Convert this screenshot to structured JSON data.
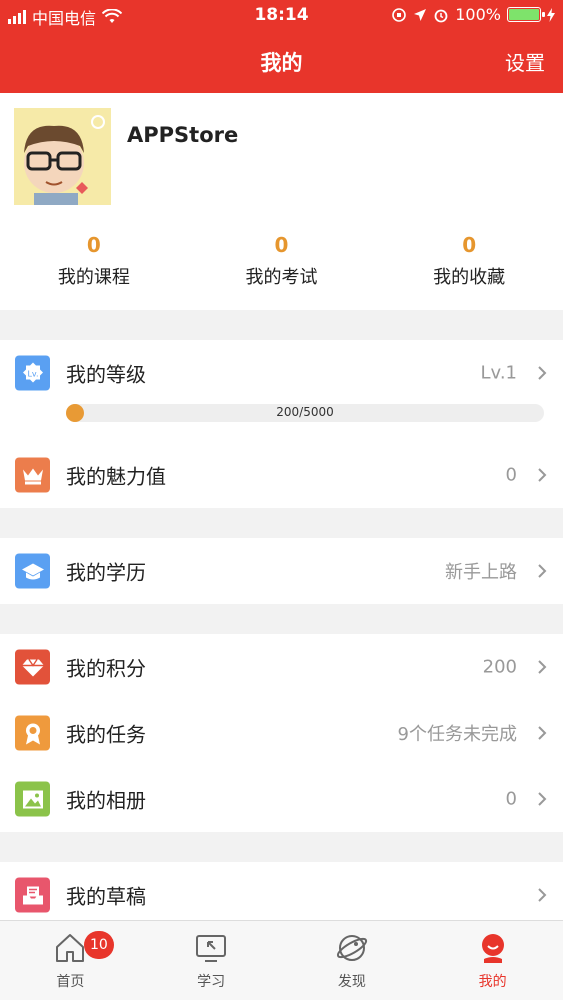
{
  "status_bar": {
    "carrier": "中国电信",
    "time": "18:14",
    "battery": "100%"
  },
  "nav": {
    "title": "我的",
    "settings_label": "设置"
  },
  "profile": {
    "username": "APPStore",
    "stats": [
      {
        "count": "0",
        "label": "我的课程"
      },
      {
        "count": "0",
        "label": "我的考试"
      },
      {
        "count": "0",
        "label": "我的收藏"
      }
    ]
  },
  "rows": {
    "level": {
      "label": "我的等级",
      "value": "Lv.1",
      "icon": "level-badge-icon",
      "color": "#5aa0f2"
    },
    "level_progress": {
      "text": "200/5000",
      "fraction": 0.04
    },
    "charm": {
      "label": "我的魅力值",
      "value": "0",
      "icon": "crown-icon",
      "color": "#ec7d4c"
    },
    "education": {
      "label": "我的学历",
      "value": "新手上路",
      "icon": "graduation-cap-icon",
      "color": "#5aa0f2"
    },
    "points": {
      "label": "我的积分",
      "value": "200",
      "icon": "diamond-icon",
      "color": "#e2523a"
    },
    "tasks": {
      "label": "我的任务",
      "value": "9个任务未完成",
      "icon": "award-ribbon-icon",
      "color": "#ef9a3d"
    },
    "album": {
      "label": "我的相册",
      "value": "0",
      "icon": "picture-icon",
      "color": "#8bc34a"
    },
    "drafts": {
      "label": "我的草稿",
      "value": "",
      "icon": "drafts-tray-icon",
      "color": "#e8566c"
    }
  },
  "tabbar": {
    "tabs": [
      {
        "label": "首页",
        "icon": "home-icon",
        "badge": "10"
      },
      {
        "label": "学习",
        "icon": "study-icon"
      },
      {
        "label": "发现",
        "icon": "discover-planet-icon"
      },
      {
        "label": "我的",
        "icon": "profile-icon",
        "active": true
      }
    ]
  },
  "colors": {
    "brand": "#e8352b",
    "accent_orange": "#e6962e",
    "background": "#f2f2f2"
  }
}
